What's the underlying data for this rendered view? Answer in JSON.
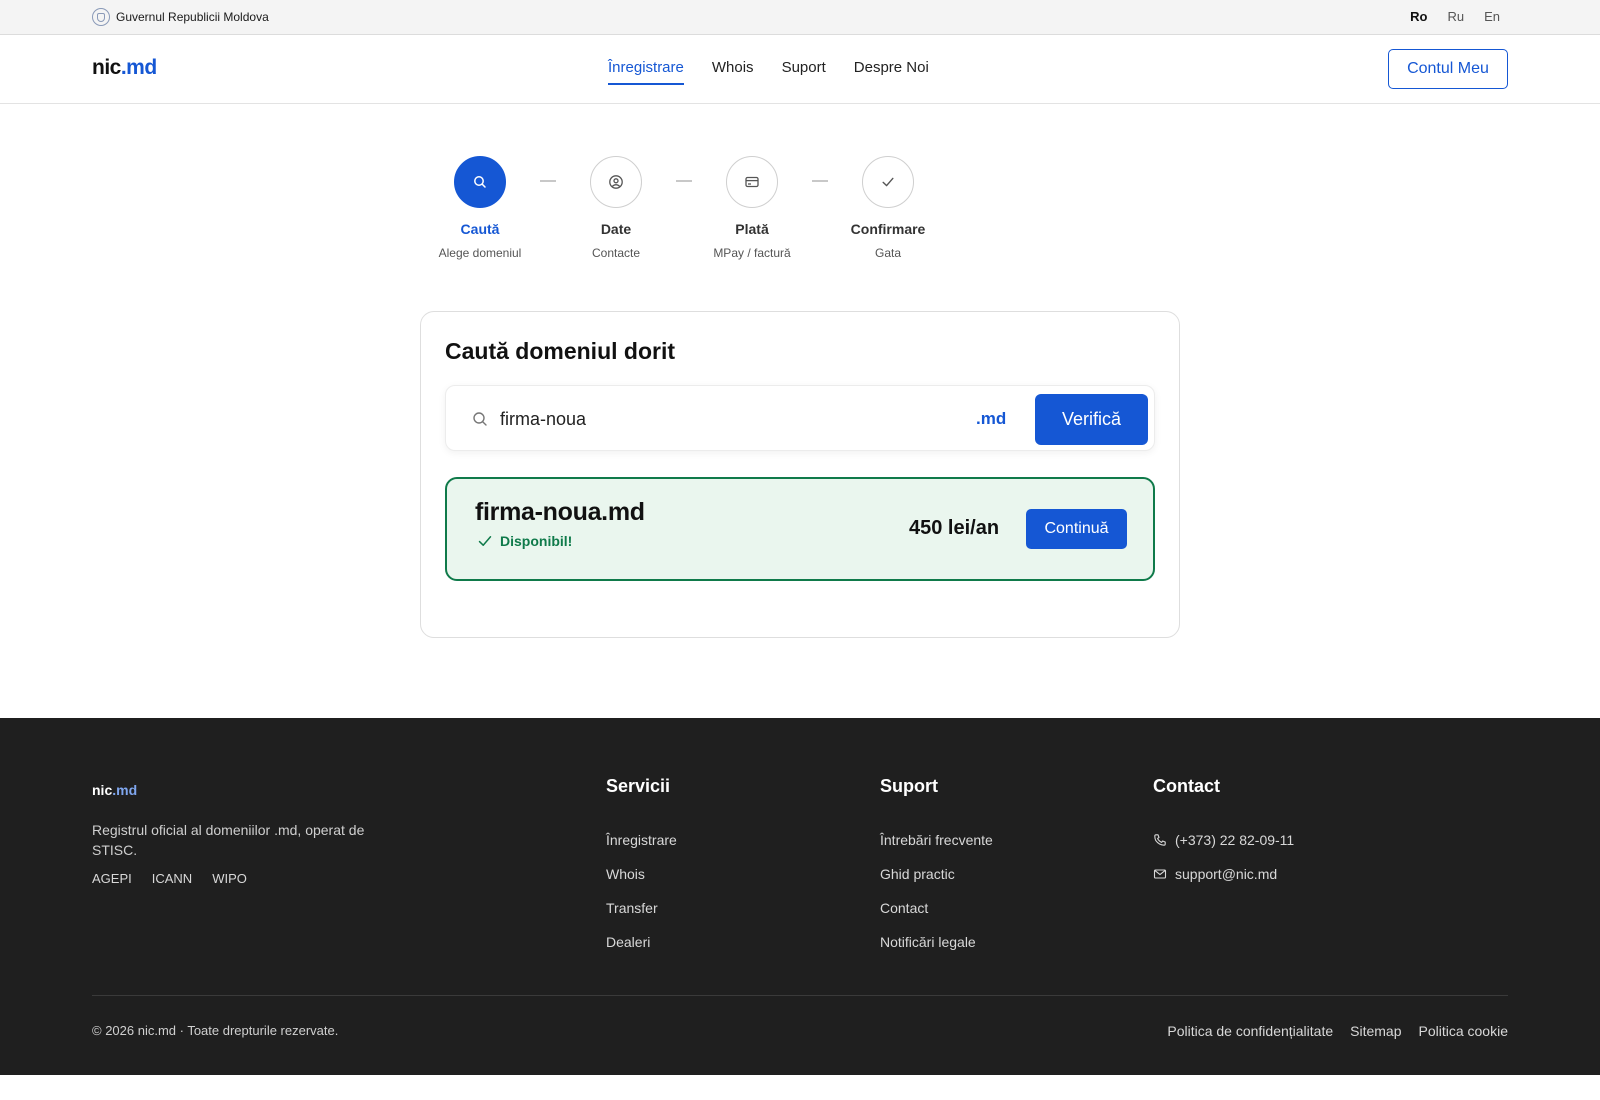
{
  "gov_bar": {
    "label": "Guvernul Republicii Moldova",
    "languages": [
      {
        "code": "Ro",
        "active": true
      },
      {
        "code": "Ru",
        "active": false
      },
      {
        "code": "En",
        "active": false
      }
    ]
  },
  "header": {
    "logo_main": "nic",
    "logo_accent": ".md",
    "nav": [
      {
        "label": "Înregistrare",
        "active": true
      },
      {
        "label": "Whois",
        "active": false
      },
      {
        "label": "Suport",
        "active": false
      },
      {
        "label": "Despre Noi",
        "active": false
      }
    ],
    "account_label": "Contul Meu"
  },
  "stepper": {
    "steps": [
      {
        "title": "Caută",
        "subtitle": "Alege domeniul",
        "icon": "search-icon",
        "active": true
      },
      {
        "title": "Date",
        "subtitle": "Contacte",
        "icon": "user-circle-icon",
        "active": false
      },
      {
        "title": "Plată",
        "subtitle": "MPay / factură",
        "icon": "credit-card-icon",
        "active": false
      },
      {
        "title": "Confirmare",
        "subtitle": "Gata",
        "icon": "check-icon",
        "active": false
      }
    ]
  },
  "search": {
    "title": "Caută domeniul dorit",
    "query": "firma-noua",
    "tld": ".md",
    "verify_label": "Verifică"
  },
  "result": {
    "domain": "firma-noua.md",
    "status": "Disponibil!",
    "price": "450 lei/an",
    "continue_label": "Continuă"
  },
  "footer": {
    "logo_main": "nic",
    "logo_accent": ".md",
    "description": "Registrul oficial al domeniilor .md, operat de STISC.",
    "badges": [
      "AGEPI",
      "ICANN",
      "WIPO"
    ],
    "services": {
      "title": "Servicii",
      "items": [
        "Înregistrare",
        "Whois",
        "Transfer",
        "Dealeri"
      ]
    },
    "support": {
      "title": "Suport",
      "items": [
        "Întrebări frecvente",
        "Ghid practic",
        "Contact",
        "Notificări legale"
      ]
    },
    "contact": {
      "title": "Contact",
      "phone": "(+373) 22 82-09-11",
      "email": "support@nic.md"
    },
    "copyright": "© 2026 nic.md · Toate drepturile rezervate.",
    "legal": [
      "Politica de confidențialitate",
      "Sitemap",
      "Politica cookie"
    ]
  },
  "colors": {
    "primary": "#1557d4",
    "success": "#0f7a4a",
    "success_bg": "#eaf6ee",
    "footer_bg": "#1f1f1f"
  }
}
